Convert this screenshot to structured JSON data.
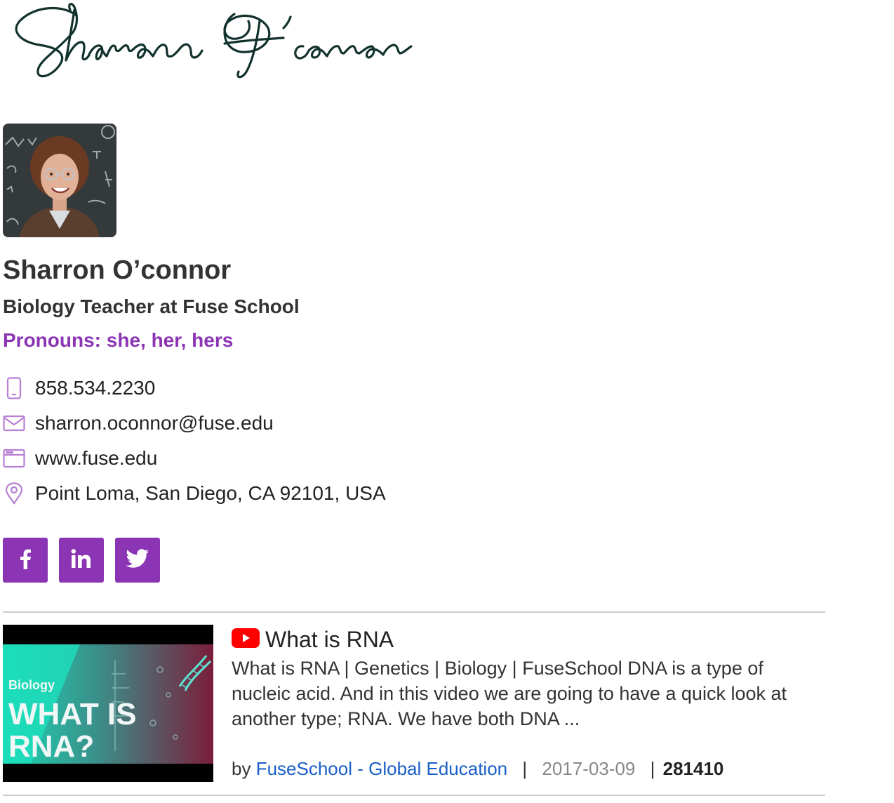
{
  "signature": {
    "text": "Sharron O'connor",
    "ink_color": "#12322e"
  },
  "profile": {
    "name": "Sharron O’connor",
    "title": "Biology Teacher at Fuse School",
    "pronouns": "Pronouns: she, her, hers",
    "accent_color": "#8b35b5"
  },
  "contacts": [
    {
      "icon": "mobile-phone-icon",
      "text": "858.534.2230"
    },
    {
      "icon": "envelope-icon",
      "text": "sharron.oconnor@fuse.edu"
    },
    {
      "icon": "browser-window-icon",
      "text": "www.fuse.edu"
    },
    {
      "icon": "map-pin-icon",
      "text": "Point Loma, San Diego, CA 92101, USA"
    }
  ],
  "social": [
    {
      "icon": "facebook-icon",
      "network": "Facebook"
    },
    {
      "icon": "linkedin-icon",
      "network": "LinkedIn"
    },
    {
      "icon": "twitter-icon",
      "network": "Twitter"
    }
  ],
  "video": {
    "thumbnail": {
      "label": "Biology",
      "line1": "WHAT IS",
      "line2": "RNA?"
    },
    "title": "What is RNA",
    "description": "What is RNA | Genetics | Biology | FuseSchool DNA is a type of nucleic acid. And in this video we are going to have a quick look at another type; RNA. We have both DNA ...",
    "by_label": "by",
    "channel": "FuseSchool - Global Education",
    "separator": "|",
    "date": "2017-03-09",
    "views": "281410"
  }
}
